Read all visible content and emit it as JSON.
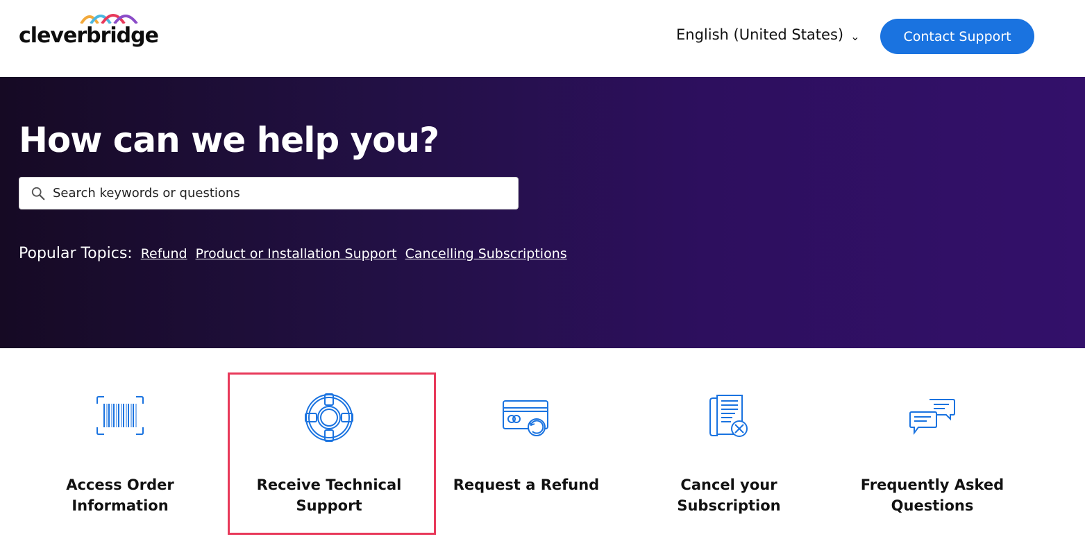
{
  "header": {
    "logo_text": "cleverbridge",
    "language": "English (United States)",
    "language_chevron": "⌄",
    "contact_button": "Contact Support"
  },
  "hero": {
    "title": "How can we help you?",
    "search_placeholder": "Search keywords or questions",
    "popular_label": "Popular Topics:",
    "popular_links": [
      "Refund",
      "Product or Installation Support",
      "Cancelling Subscriptions"
    ]
  },
  "cards": [
    {
      "label": "Access Order Information",
      "icon": "barcode-icon"
    },
    {
      "label": "Receive Technical Support",
      "icon": "lifebuoy-icon",
      "highlighted": true
    },
    {
      "label": "Request a Refund",
      "icon": "credit-card-refund-icon"
    },
    {
      "label": "Cancel your Subscription",
      "icon": "cancel-document-icon"
    },
    {
      "label": "Frequently Asked Questions",
      "icon": "chat-bubbles-icon"
    }
  ],
  "colors": {
    "accent": "#1a73e0",
    "hero_dark": "#160a24",
    "hero_purple": "#33106a",
    "highlight": "#e8395a",
    "icon_blue": "#1a73e0"
  }
}
